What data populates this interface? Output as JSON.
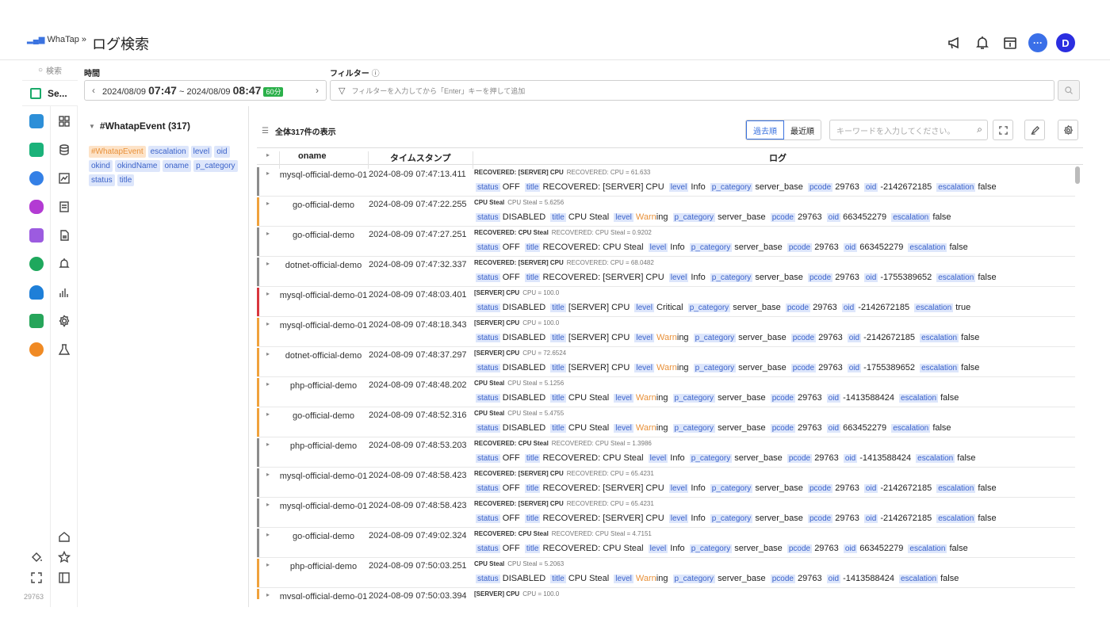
{
  "header": {
    "logo_text": "WhaTap",
    "logo_chevron": "»",
    "page_title": "ログ検索",
    "icons": [
      "megaphone-icon",
      "bell-icon",
      "calendar-icon",
      "chat-icon",
      "user-avatar"
    ],
    "chat_glyph": "···",
    "user_initial": "D"
  },
  "rail": {
    "search_label": "検索",
    "selector_label": "Se...",
    "footer_code": "29763"
  },
  "time": {
    "label": "時間",
    "start_date": "2024/08/09",
    "start_time": "07:47",
    "separator": "~",
    "end_date": "2024/08/09",
    "end_time": "08:47",
    "duration_badge": "60分"
  },
  "filter": {
    "label": "フィルター",
    "placeholder": "フィルターを入力してから「Enter」キーを押して追加"
  },
  "left_panel": {
    "tree_title": "#WhatapEvent (317)",
    "tags": [
      {
        "text": "#WhatapEvent",
        "style": "orange"
      },
      {
        "text": "escalation",
        "style": "blue"
      },
      {
        "text": "level",
        "style": "blue"
      },
      {
        "text": "oid",
        "style": "blue"
      },
      {
        "text": "okind",
        "style": "blue"
      },
      {
        "text": "okindName",
        "style": "blue"
      },
      {
        "text": "oname",
        "style": "blue"
      },
      {
        "text": "p_category",
        "style": "blue"
      },
      {
        "text": "status",
        "style": "blue"
      },
      {
        "text": "title",
        "style": "blue"
      }
    ]
  },
  "toolbar": {
    "count_label": "全体317件の表示",
    "sort_oldest": "過去順",
    "sort_newest": "最近順",
    "keyword_placeholder": "キーワードを入力してください。"
  },
  "table": {
    "headers": {
      "oname": "oname",
      "timestamp": "タイムスタンプ",
      "log": "ログ"
    },
    "rows": [
      {
        "bar": "#8c8c8c",
        "oname": "mysql-official-demo-01",
        "ts": "2024-08-09  07:47:13.411",
        "head": "RECOVERED: [SERVER] CPU",
        "msg": "RECOVERED: CPU = 61.633",
        "status": "OFF",
        "title": "RECOVERED: [SERVER] CPU",
        "level": "Info",
        "p_category": "server_base",
        "pcode": "29763",
        "oid": "-2142672185",
        "escalation": "false"
      },
      {
        "bar": "#f0a23c",
        "oname": "go-official-demo",
        "ts": "2024-08-09  07:47:22.255",
        "head": "CPU Steal",
        "msg": "CPU Steal = 5.6256",
        "status": "DISABLED",
        "title": "CPU Steal",
        "level": "Warning",
        "p_category": "server_base",
        "pcode": "29763",
        "oid": "663452279",
        "escalation": "false"
      },
      {
        "bar": "#8c8c8c",
        "oname": "go-official-demo",
        "ts": "2024-08-09  07:47:27.251",
        "head": "RECOVERED: CPU Steal",
        "msg": "RECOVERED: CPU Steal = 0.9202",
        "status": "OFF",
        "title": "RECOVERED: CPU Steal",
        "level": "Info",
        "p_category": "server_base",
        "pcode": "29763",
        "oid": "663452279",
        "escalation": "false"
      },
      {
        "bar": "#8c8c8c",
        "oname": "dotnet-official-demo",
        "ts": "2024-08-09  07:47:32.337",
        "head": "RECOVERED: [SERVER] CPU",
        "msg": "RECOVERED: CPU = 68.0482",
        "status": "OFF",
        "title": "RECOVERED: [SERVER] CPU",
        "level": "Info",
        "p_category": "server_base",
        "pcode": "29763",
        "oid": "-1755389652",
        "escalation": "false"
      },
      {
        "bar": "#d9363e",
        "oname": "mysql-official-demo-01",
        "ts": "2024-08-09  07:48:03.401",
        "head": "[SERVER] CPU",
        "msg": "CPU = 100.0",
        "status": "DISABLED",
        "title": "[SERVER] CPU",
        "level": "Critical",
        "p_category": "server_base",
        "pcode": "29763",
        "oid": "-2142672185",
        "escalation": "true"
      },
      {
        "bar": "#f0a23c",
        "oname": "mysql-official-demo-01",
        "ts": "2024-08-09  07:48:18.343",
        "head": "[SERVER] CPU",
        "msg": "CPU = 100.0",
        "status": "DISABLED",
        "title": "[SERVER] CPU",
        "level": "Warning",
        "p_category": "server_base",
        "pcode": "29763",
        "oid": "-2142672185",
        "escalation": "false"
      },
      {
        "bar": "#f0a23c",
        "oname": "dotnet-official-demo",
        "ts": "2024-08-09  07:48:37.297",
        "head": "[SERVER] CPU",
        "msg": "CPU = 72.6524",
        "status": "DISABLED",
        "title": "[SERVER] CPU",
        "level": "Warning",
        "p_category": "server_base",
        "pcode": "29763",
        "oid": "-1755389652",
        "escalation": "false"
      },
      {
        "bar": "#f0a23c",
        "oname": "php-official-demo",
        "ts": "2024-08-09  07:48:48.202",
        "head": "CPU Steal",
        "msg": "CPU Steal = 5.1256",
        "status": "DISABLED",
        "title": "CPU Steal",
        "level": "Warning",
        "p_category": "server_base",
        "pcode": "29763",
        "oid": "-1413588424",
        "escalation": "false"
      },
      {
        "bar": "#f0a23c",
        "oname": "go-official-demo",
        "ts": "2024-08-09  07:48:52.316",
        "head": "CPU Steal",
        "msg": "CPU Steal = 5.4755",
        "status": "DISABLED",
        "title": "CPU Steal",
        "level": "Warning",
        "p_category": "server_base",
        "pcode": "29763",
        "oid": "663452279",
        "escalation": "false"
      },
      {
        "bar": "#8c8c8c",
        "oname": "php-official-demo",
        "ts": "2024-08-09  07:48:53.203",
        "head": "RECOVERED: CPU Steal",
        "msg": "RECOVERED: CPU Steal = 1.3986",
        "status": "OFF",
        "title": "RECOVERED: CPU Steal",
        "level": "Info",
        "p_category": "server_base",
        "pcode": "29763",
        "oid": "-1413588424",
        "escalation": "false"
      },
      {
        "bar": "#8c8c8c",
        "oname": "mysql-official-demo-01",
        "ts": "2024-08-09  07:48:58.423",
        "head": "RECOVERED: [SERVER] CPU",
        "msg": "RECOVERED: CPU = 65.4231",
        "status": "OFF",
        "title": "RECOVERED: [SERVER] CPU",
        "level": "Info",
        "p_category": "server_base",
        "pcode": "29763",
        "oid": "-2142672185",
        "escalation": "false"
      },
      {
        "bar": "#8c8c8c",
        "oname": "mysql-official-demo-01",
        "ts": "2024-08-09  07:48:58.423",
        "head": "RECOVERED: [SERVER] CPU",
        "msg": "RECOVERED: CPU = 65.4231",
        "status": "OFF",
        "title": "RECOVERED: [SERVER] CPU",
        "level": "Info",
        "p_category": "server_base",
        "pcode": "29763",
        "oid": "-2142672185",
        "escalation": "false"
      },
      {
        "bar": "#8c8c8c",
        "oname": "go-official-demo",
        "ts": "2024-08-09  07:49:02.324",
        "head": "RECOVERED: CPU Steal",
        "msg": "RECOVERED: CPU Steal = 4.7151",
        "status": "OFF",
        "title": "RECOVERED: CPU Steal",
        "level": "Info",
        "p_category": "server_base",
        "pcode": "29763",
        "oid": "663452279",
        "escalation": "false"
      },
      {
        "bar": "#f0a23c",
        "oname": "php-official-demo",
        "ts": "2024-08-09  07:50:03.251",
        "head": "CPU Steal",
        "msg": "CPU Steal = 5.2063",
        "status": "DISABLED",
        "title": "CPU Steal",
        "level": "Warning",
        "p_category": "server_base",
        "pcode": "29763",
        "oid": "-1413588424",
        "escalation": "false"
      },
      {
        "bar": "#f0a23c",
        "oname": "mysql-official-demo-01",
        "ts": "2024-08-09  07:50:03.394",
        "head": "[SERVER] CPU",
        "msg": "CPU = 100.0",
        "status": "",
        "title": "",
        "level": "",
        "p_category": "",
        "pcode": "",
        "oid": "",
        "escalation": ""
      }
    ]
  },
  "colors": {
    "accent": "#3b73e0",
    "warning": "#f0a23c",
    "critical": "#d9363e",
    "info": "#8c8c8c",
    "badge_green": "#2bb04a"
  }
}
